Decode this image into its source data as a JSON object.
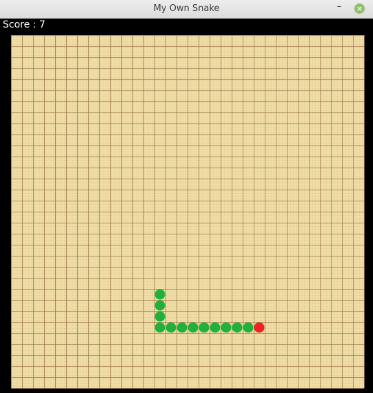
{
  "window": {
    "title": "My Own Snake",
    "minimize_symbol": "–",
    "close_symbol": "×"
  },
  "hud": {
    "score_text": "Score : 7"
  },
  "board": {
    "cols": 32,
    "rows": 32,
    "colors": {
      "background": "#efdca4",
      "grid_line": "#a07a4e",
      "dot": "#c5a878",
      "snake": "#21b13a",
      "food": "#ee2222"
    }
  },
  "snake": {
    "segments": [
      [
        13,
        23
      ],
      [
        13,
        24
      ],
      [
        13,
        25
      ],
      [
        13,
        26
      ],
      [
        14,
        26
      ],
      [
        15,
        26
      ],
      [
        16,
        26
      ],
      [
        17,
        26
      ],
      [
        18,
        26
      ],
      [
        19,
        26
      ],
      [
        20,
        26
      ],
      [
        21,
        26
      ],
      [
        22,
        26
      ]
    ]
  },
  "food": {
    "cell": [
      22,
      26
    ]
  }
}
